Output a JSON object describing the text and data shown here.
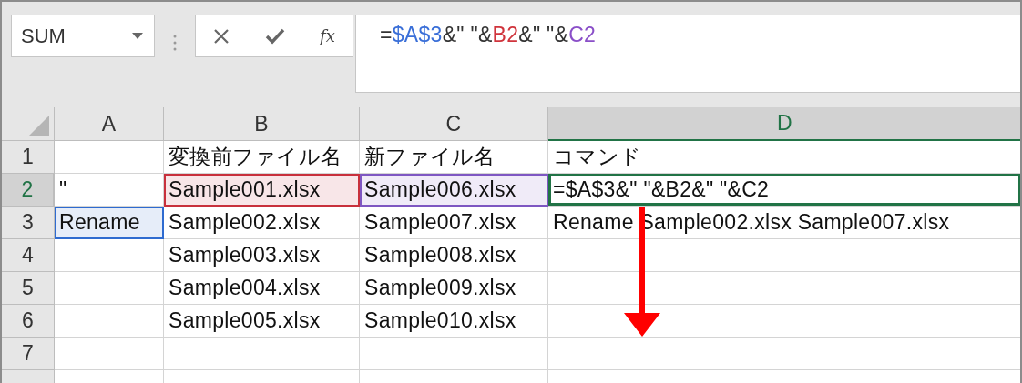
{
  "name_box": {
    "value": "SUM"
  },
  "formula_buttons": {
    "function_label": "fx"
  },
  "formula_bar": {
    "segments": [
      {
        "text": "=",
        "color": "#333333"
      },
      {
        "text": "$A$3",
        "color": "#3a6fd8"
      },
      {
        "text": "&\" \"&",
        "color": "#333333"
      },
      {
        "text": "B2",
        "color": "#d0343c"
      },
      {
        "text": "&\" \"&",
        "color": "#333333"
      },
      {
        "text": "C2",
        "color": "#8a4fc8"
      }
    ]
  },
  "columns": [
    {
      "label": "A",
      "selected": false
    },
    {
      "label": "B",
      "selected": false
    },
    {
      "label": "C",
      "selected": false
    },
    {
      "label": "D",
      "selected": true
    }
  ],
  "rows": [
    {
      "label": "1",
      "selected": false,
      "cells": [
        {
          "active": false
        },
        {
          "text": "変換前ファイル名",
          "active": false
        },
        {
          "text": "新ファイル名",
          "active": false
        },
        {
          "text": "コマンド",
          "active": false
        }
      ]
    },
    {
      "label": "2",
      "selected": true,
      "cells": [
        {
          "text": "\"",
          "active": false
        },
        {
          "text": "Sample001.xlsx",
          "active": false,
          "color": "#c8303c"
        },
        {
          "text": "Sample006.xlsx",
          "active": false,
          "color": "#7e57c2"
        },
        {
          "text": "=$A$3&\" \"&B2&\" \"&C2",
          "active": true
        }
      ]
    },
    {
      "label": "3",
      "selected": false,
      "cells": [
        {
          "text": "Rename",
          "active": false,
          "color": "#2e6bd0"
        },
        {
          "text": "Sample002.xlsx",
          "active": false
        },
        {
          "text": "Sample007.xlsx",
          "active": false
        },
        {
          "text": "Rename Sample002.xlsx Sample007.xlsx",
          "active": false
        }
      ]
    },
    {
      "label": "4",
      "selected": false,
      "cells": [
        {
          "active": false
        },
        {
          "text": "Sample003.xlsx",
          "active": false
        },
        {
          "text": "Sample008.xlsx",
          "active": false
        },
        {
          "active": false
        }
      ]
    },
    {
      "label": "5",
      "selected": false,
      "cells": [
        {
          "active": false
        },
        {
          "text": "Sample004.xlsx",
          "active": false
        },
        {
          "text": "Sample009.xlsx",
          "active": false
        },
        {
          "active": false
        }
      ]
    },
    {
      "label": "6",
      "selected": false,
      "cells": [
        {
          "active": false
        },
        {
          "text": "Sample005.xlsx",
          "active": false
        },
        {
          "text": "Sample010.xlsx",
          "active": false
        },
        {
          "active": false
        }
      ]
    },
    {
      "label": "7",
      "selected": false,
      "cells": [
        {
          "active": false
        },
        {
          "active": false
        },
        {
          "active": false
        },
        {
          "active": false
        }
      ]
    }
  ]
}
